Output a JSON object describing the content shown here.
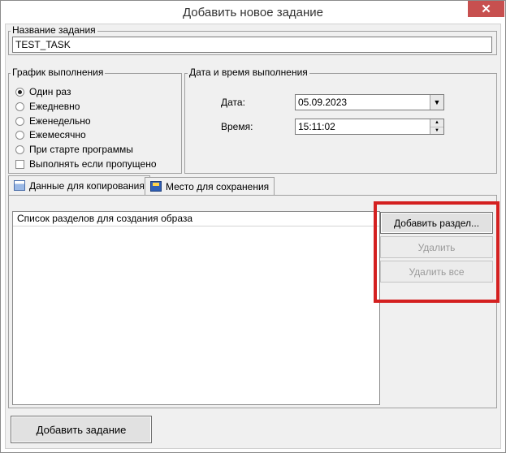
{
  "window": {
    "title": "Добавить новое задание",
    "close_label": "✕"
  },
  "task_name": {
    "legend": "Название задания",
    "value": "TEST_TASK"
  },
  "schedule": {
    "legend": "График выполнения",
    "options": [
      {
        "label": "Один раз",
        "selected": true
      },
      {
        "label": "Ежедневно",
        "selected": false
      },
      {
        "label": "Еженедельно",
        "selected": false
      },
      {
        "label": "Ежемесячно",
        "selected": false
      },
      {
        "label": "При старте программы",
        "selected": false
      }
    ],
    "run_if_missed": {
      "label": "Выполнять если пропущено",
      "checked": false
    }
  },
  "datetime": {
    "legend": "Дата и время выполнения",
    "date_label": "Дата:",
    "date_value": "05.09.2023",
    "time_label": "Время:",
    "time_value": "15:11:02"
  },
  "tabs": [
    {
      "label": "Данные для копирования",
      "icon": "document-icon",
      "active": true
    },
    {
      "label": "Место для сохранения",
      "icon": "floppy-disk-icon",
      "active": false
    }
  ],
  "partitions": {
    "header": "Список разделов для создания образа",
    "add_button": "Добавить раздел...",
    "delete_button": "Удалить",
    "delete_all_button": "Удалить все"
  },
  "footer": {
    "add_task_button": "Добавить задание"
  },
  "colors": {
    "highlight": "#d42020",
    "close_button": "#c7504f"
  }
}
